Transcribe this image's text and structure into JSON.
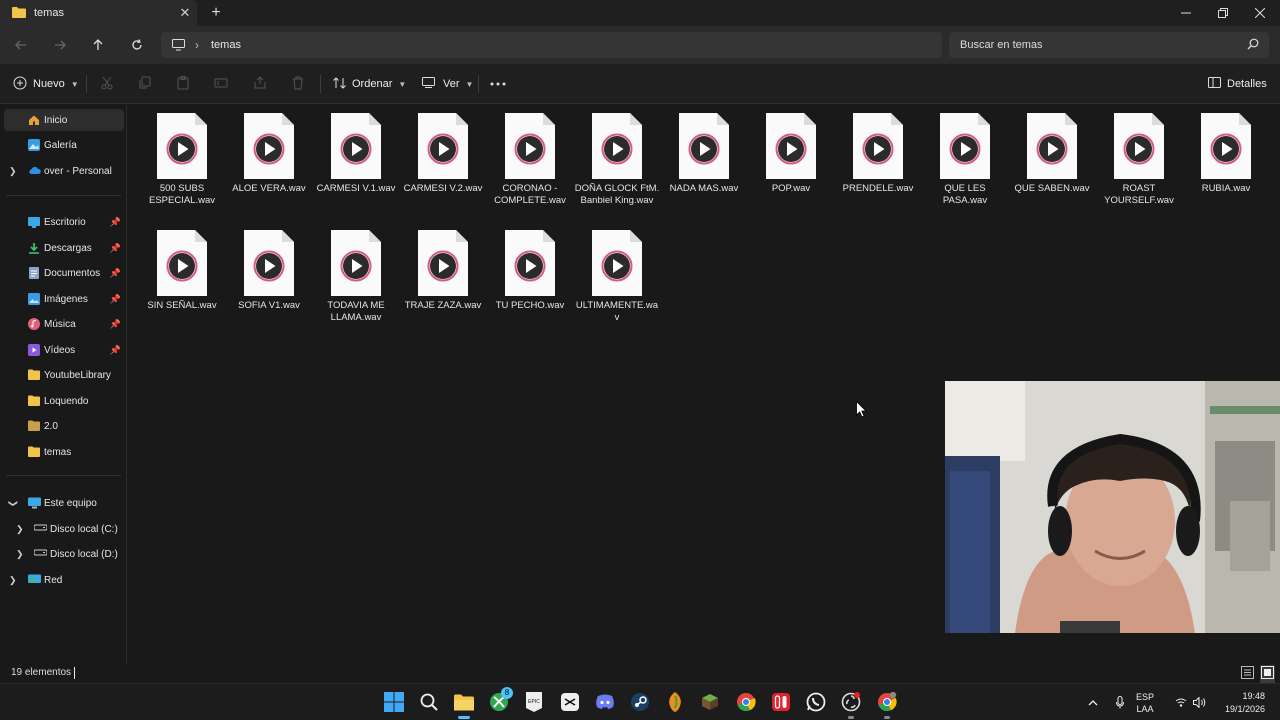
{
  "window": {
    "tab_title": "temas",
    "new_tab": "+"
  },
  "address": {
    "path_segment": "temas",
    "search_placeholder": "Buscar en temas"
  },
  "commands": {
    "new_label": "Nuevo",
    "sort_label": "Ordenar",
    "view_label": "Ver",
    "details_label": "Detalles"
  },
  "sidebar": {
    "items": [
      {
        "label": "Inicio",
        "icon": "home-icon"
      },
      {
        "label": "Galería",
        "icon": "gallery-icon"
      },
      {
        "label": "over - Personal",
        "icon": "cloud-icon"
      },
      {
        "label": "Escritorio",
        "icon": "desktop-icon"
      },
      {
        "label": "Descargas",
        "icon": "downloads-icon"
      },
      {
        "label": "Documentos",
        "icon": "documents-icon"
      },
      {
        "label": "Imágenes",
        "icon": "pictures-icon"
      },
      {
        "label": "Música",
        "icon": "music-icon"
      },
      {
        "label": "Vídeos",
        "icon": "videos-icon"
      },
      {
        "label": "YoutubeLibrary",
        "icon": "folder-icon"
      },
      {
        "label": "Loquendo",
        "icon": "folder-icon"
      },
      {
        "label": "2.0",
        "icon": "folder-icon"
      },
      {
        "label": "temas",
        "icon": "folder-icon"
      },
      {
        "label": "Este equipo",
        "icon": "computer-icon"
      },
      {
        "label": "Disco local (C:)",
        "icon": "drive-icon"
      },
      {
        "label": "Disco local (D:)",
        "icon": "drive-icon"
      },
      {
        "label": "Red",
        "icon": "network-icon"
      }
    ]
  },
  "files": [
    {
      "name": "500 SUBS ESPECIAL.wav"
    },
    {
      "name": "ALOE VERA.wav"
    },
    {
      "name": "CARMESI V.1.wav"
    },
    {
      "name": "CARMESI V.2.wav"
    },
    {
      "name": "CORONAO - COMPLETE.wav"
    },
    {
      "name": "DOÑA GLOCK FtM. Banbiel King.wav"
    },
    {
      "name": "NADA MAS.wav"
    },
    {
      "name": "POP.wav"
    },
    {
      "name": "PRENDELE.wav"
    },
    {
      "name": "QUE LES PASA.wav"
    },
    {
      "name": "QUE SABEN.wav"
    },
    {
      "name": "ROAST YOURSELF.wav"
    },
    {
      "name": "RUBIA.wav"
    },
    {
      "name": "SIN SEÑAL.wav"
    },
    {
      "name": "SOFIA V1.wav"
    },
    {
      "name": "TODAVIA ME LLAMA.wav"
    },
    {
      "name": "TRAJE ZAZA.wav"
    },
    {
      "name": "TU PECHO.wav"
    },
    {
      "name": "ULTIMAMENTE.wav"
    }
  ],
  "status": {
    "item_count": "19 elementos"
  },
  "taskbar": {
    "language_line1": "ESP",
    "language_line2": "LAA",
    "time": "19:48",
    "date": "19/1/2026",
    "xbox_badge": "8"
  },
  "colors": {
    "accent": "#4cc2ff",
    "folder": "#f3c44b",
    "play_ring": "#d85a7a"
  }
}
